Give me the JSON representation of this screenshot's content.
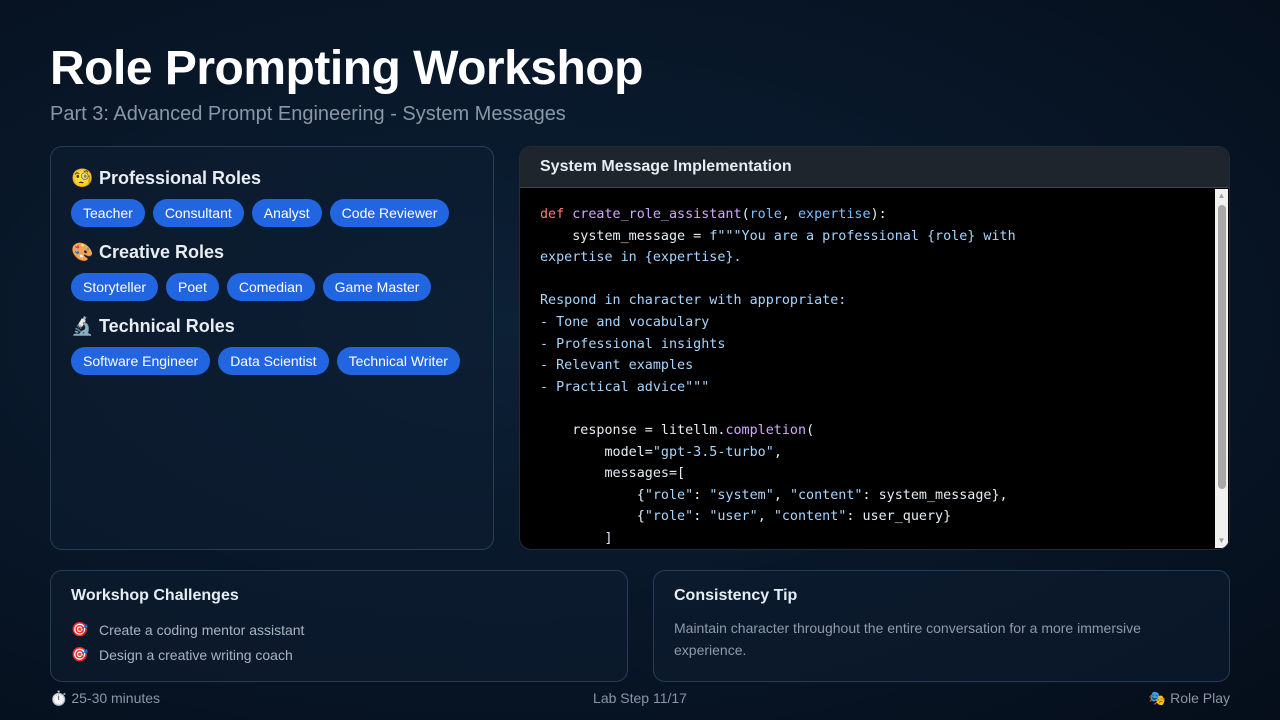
{
  "header": {
    "title": "Role Prompting Workshop",
    "subtitle": "Part 3: Advanced Prompt Engineering - System Messages"
  },
  "roles": {
    "groups": [
      {
        "icon": "🧐",
        "icon_name": "monocle-face-icon",
        "title": "Professional Roles",
        "chips": [
          "Teacher",
          "Consultant",
          "Analyst",
          "Code Reviewer"
        ]
      },
      {
        "icon": "🎨",
        "icon_name": "palette-icon",
        "title": "Creative Roles",
        "chips": [
          "Storyteller",
          "Poet",
          "Comedian",
          "Game Master"
        ]
      },
      {
        "icon": "🔬",
        "icon_name": "microscope-icon",
        "title": "Technical Roles",
        "chips": [
          "Software Engineer",
          "Data Scientist",
          "Technical Writer"
        ]
      }
    ]
  },
  "code": {
    "title": "System Message Implementation",
    "lines": [
      [
        [
          "kw",
          "def "
        ],
        [
          "fn",
          "create_role_assistant"
        ],
        [
          "",
          "("
        ],
        [
          "pm",
          "role"
        ],
        [
          "",
          ", "
        ],
        [
          "pm",
          "expertise"
        ],
        [
          "",
          "):"
        ]
      ],
      [
        [
          "",
          "    system_message = "
        ],
        [
          "st",
          "f\"\"\"You are a professional {role} with"
        ]
      ],
      [
        [
          "st",
          "expertise in {expertise}."
        ]
      ],
      [
        [
          "",
          ""
        ]
      ],
      [
        [
          "st",
          "Respond in character with appropriate:"
        ]
      ],
      [
        [
          "st",
          "- Tone and vocabulary"
        ]
      ],
      [
        [
          "st",
          "- Professional insights"
        ]
      ],
      [
        [
          "st",
          "- Relevant examples"
        ]
      ],
      [
        [
          "st",
          "- Practical advice\"\"\""
        ]
      ],
      [
        [
          "",
          ""
        ]
      ],
      [
        [
          "",
          "    response = litellm."
        ],
        [
          "fn",
          "completion"
        ],
        [
          "",
          "("
        ]
      ],
      [
        [
          "",
          "        model="
        ],
        [
          "st",
          "\"gpt-3.5-turbo\""
        ],
        [
          "",
          ","
        ]
      ],
      [
        [
          "",
          "        messages=["
        ]
      ],
      [
        [
          "",
          "            {"
        ],
        [
          "st",
          "\"role\""
        ],
        [
          "",
          ": "
        ],
        [
          "st",
          "\"system\""
        ],
        [
          "",
          ", "
        ],
        [
          "st",
          "\"content\""
        ],
        [
          "",
          ": system_message},"
        ]
      ],
      [
        [
          "",
          "            {"
        ],
        [
          "st",
          "\"role\""
        ],
        [
          "",
          ": "
        ],
        [
          "st",
          "\"user\""
        ],
        [
          "",
          ", "
        ],
        [
          "st",
          "\"content\""
        ],
        [
          "",
          ": user_query}"
        ]
      ],
      [
        [
          "",
          "        ]"
        ]
      ]
    ]
  },
  "challenges": {
    "title": "Workshop Challenges",
    "icon": "🎯",
    "items": [
      "Create a coding mentor assistant",
      "Design a creative writing coach"
    ]
  },
  "tip": {
    "title": "Consistency Tip",
    "text": "Maintain character throughout the entire conversation for a more immersive experience."
  },
  "footer": {
    "duration_icon": "⏱️",
    "duration": "25-30 minutes",
    "step": "Lab Step 11/17",
    "mode_icon": "🎭",
    "mode": "Role Play"
  },
  "colors": {
    "chip": "#2166e0",
    "keyword": "#ff7b72",
    "function": "#d2a8ff",
    "param": "#79c0ff",
    "string": "#a5d6ff"
  }
}
